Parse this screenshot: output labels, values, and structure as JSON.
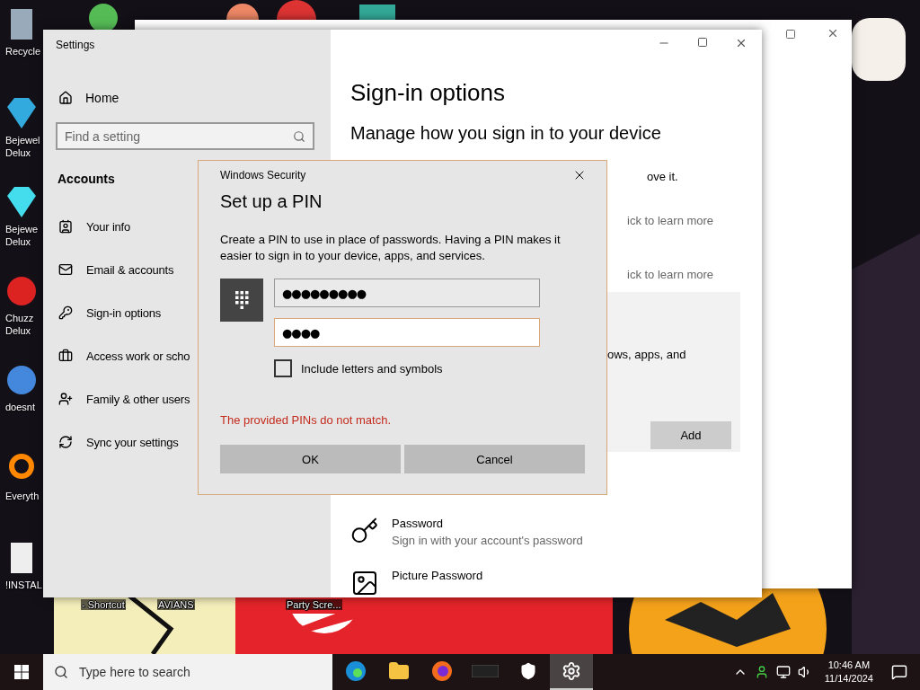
{
  "desktop": {
    "icons": [
      {
        "kind": "bin",
        "label": "Recycle"
      },
      {
        "kind": "gem2",
        "label": "Bejewel\nDelux"
      },
      {
        "kind": "gem",
        "label": "Bejewe\nDelux"
      },
      {
        "kind": "ball",
        "label": "Chuzz\nDelux"
      },
      {
        "kind": "bird",
        "label": "doesnt"
      },
      {
        "kind": "magnifier",
        "label": "Everyth"
      },
      {
        "kind": "doc",
        "label": "!INSTAL"
      }
    ],
    "bottom_labels": [
      {
        "label": "- Shortcut"
      },
      {
        "label": "AVIANS"
      },
      {
        "label": "Party Scre..."
      }
    ]
  },
  "settings": {
    "title": "Settings",
    "home": "Home",
    "search": {
      "placeholder": "Find a setting"
    },
    "section": "Accounts",
    "nav": [
      {
        "kind": "info",
        "label": "Your info"
      },
      {
        "kind": "mail",
        "label": "Email & accounts"
      },
      {
        "kind": "key",
        "label": "Sign-in options"
      },
      {
        "kind": "briefcase",
        "label": "Access work or scho"
      },
      {
        "kind": "adduser",
        "label": "Family & other users"
      },
      {
        "kind": "sync",
        "label": "Sync your settings"
      }
    ],
    "page_title": "Sign-in options",
    "subtitle": "Manage how you sign in to your device",
    "covered_lines": [
      {
        "kind": "text",
        "text": "ove it."
      },
      {
        "kind": "link",
        "text": "ick to learn more"
      },
      {
        "kind": "link",
        "text": "ick to learn more"
      }
    ],
    "panel": {
      "text": "ows, apps, and",
      "button": "Add"
    },
    "options": [
      {
        "kind": "password",
        "title": "Password",
        "desc": "Sign in with your account's password"
      },
      {
        "kind": "picture",
        "title": "Picture Password"
      }
    ]
  },
  "dialog": {
    "caption": "Windows Security",
    "title": "Set up a PIN",
    "text": "Create a PIN to use in place of passwords. Having a PIN makes it easier to sign in to your device, apps, and services.",
    "fields": [
      {
        "value": "●●●●●●●●●",
        "focused": false
      },
      {
        "value": "●●●●",
        "focused": true
      }
    ],
    "checkbox": {
      "label": "Include letters and symbols",
      "checked": false
    },
    "error": "The provided PINs do not match.",
    "buttons": [
      "OK",
      "Cancel"
    ]
  },
  "taskbar": {
    "search": {
      "placeholder": "Type here to search"
    },
    "apps": [
      {
        "kind": "edge",
        "selected": false
      },
      {
        "kind": "folder",
        "selected": false
      },
      {
        "kind": "firefox",
        "selected": false
      },
      {
        "kind": "dark",
        "selected": false
      },
      {
        "kind": "shield",
        "selected": false
      },
      {
        "kind": "gear",
        "selected": true
      }
    ],
    "time": "10:46 AM",
    "date": "11/14/2024"
  }
}
